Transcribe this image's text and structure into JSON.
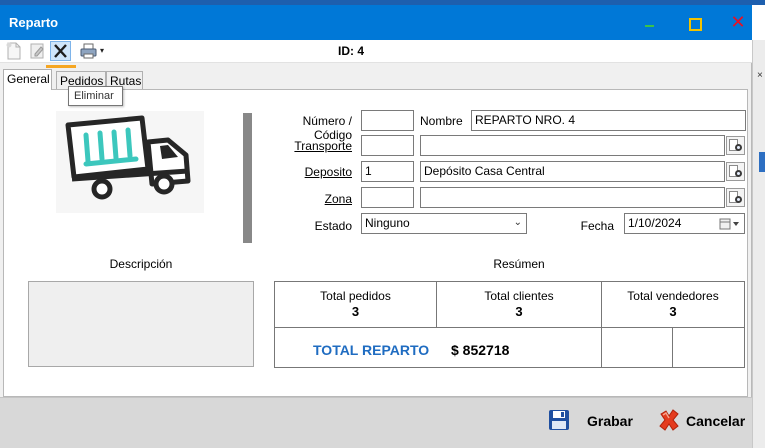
{
  "window": {
    "title": "Reparto"
  },
  "toolbar": {
    "id_label": "ID: 4",
    "tooltip": "Eliminar",
    "dropdown_glyph": "▾"
  },
  "tabs": [
    {
      "label": "General",
      "active": true
    },
    {
      "label": "Pedidos",
      "active": false
    },
    {
      "label": "Rutas",
      "active": false
    }
  ],
  "form": {
    "numero_label": "Número / Código",
    "numero_value": "",
    "nombre_label": "Nombre",
    "nombre_value": "REPARTO NRO. 4",
    "transporte_label": "Transporte",
    "transporte_code": "",
    "transporte_name": "",
    "deposito_label": "Deposito",
    "deposito_code": "1",
    "deposito_name": "Depósito Casa Central",
    "zona_label": "Zona",
    "zona_code": "",
    "zona_name": "",
    "estado_label": "Estado",
    "estado_value": "Ninguno",
    "fecha_label": "Fecha",
    "fecha_value": "1/10/2024"
  },
  "descripcion": {
    "title": "Descripción"
  },
  "resumen": {
    "title": "Resúmen",
    "total_pedidos_label": "Total pedidos",
    "total_pedidos": "3",
    "total_clientes_label": "Total clientes",
    "total_clientes": "3",
    "total_vendedores_label": "Total vendedores",
    "total_vendedores": "3",
    "total_reparto_label": "TOTAL REPARTO",
    "total_reparto_value": "$ 852718"
  },
  "actions": {
    "save_label": "Grabar",
    "cancel_label": "Cancelar"
  },
  "icons": {
    "toolbar": [
      "new-document-icon",
      "edit-document-icon",
      "delete-x-icon",
      "printer-icon"
    ],
    "lookup": "search-document-icon",
    "save": "floppy-disk-icon",
    "cancel": "red-x-icon",
    "truck": "delivery-truck-icon"
  },
  "colors": {
    "titlebar": "#0078d7",
    "accent_underline": "#f5a623",
    "total_label": "#1f6cc1",
    "truck_teal": "#3cc7bd",
    "truck_dark": "#262626"
  }
}
